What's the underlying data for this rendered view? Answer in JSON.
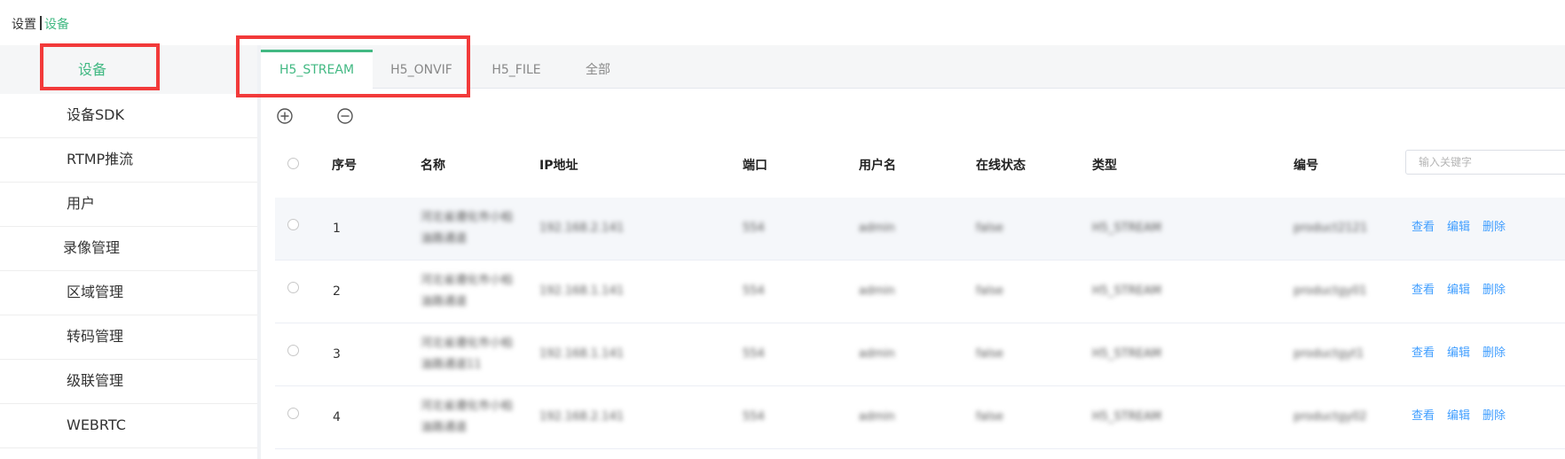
{
  "breadcrumb": {
    "root": "设置",
    "current": "设备"
  },
  "sidebar": {
    "header": "设备",
    "items": [
      {
        "label": "设备SDK"
      },
      {
        "label": "RTMP推流"
      },
      {
        "label": "用户"
      },
      {
        "label": "录像管理"
      },
      {
        "label": "区域管理"
      },
      {
        "label": "转码管理"
      },
      {
        "label": "级联管理"
      },
      {
        "label": "WEBRTC"
      }
    ]
  },
  "tabs": [
    {
      "label": "H5_STREAM",
      "active": true
    },
    {
      "label": "H5_ONVIF",
      "active": false
    },
    {
      "label": "H5_FILE",
      "active": false
    },
    {
      "label": "全部",
      "active": false
    }
  ],
  "toolbar": {
    "add_icon": "plus-circle-icon",
    "remove_icon": "minus-circle-icon"
  },
  "table": {
    "columns": [
      "序号",
      "名称",
      "IP地址",
      "端口",
      "用户名",
      "在线状态",
      "类型",
      "编号"
    ],
    "search_placeholder": "输入关键字",
    "actions": {
      "view": "查看",
      "edit": "编辑",
      "delete": "删除"
    },
    "rows": [
      {
        "index": "1",
        "name": "河北省遵化市小柏油路通道",
        "ip": "192.168.2.141",
        "port": "554",
        "user": "admin",
        "status": "false",
        "type": "H5_STREAM",
        "code": "product2121"
      },
      {
        "index": "2",
        "name": "河北省遵化市小柏油路通道",
        "ip": "192.168.1.141",
        "port": "554",
        "user": "admin",
        "status": "false",
        "type": "H5_STREAM",
        "code": "productgy01"
      },
      {
        "index": "3",
        "name": "河北省遵化市小柏油路通道11",
        "ip": "192.168.1.141",
        "port": "554",
        "user": "admin",
        "status": "false",
        "type": "H5_STREAM",
        "code": "productgyt1"
      },
      {
        "index": "4",
        "name": "河北省遵化市小柏油路通道",
        "ip": "192.168.2.141",
        "port": "554",
        "user": "admin",
        "status": "false",
        "type": "H5_STREAM",
        "code": "productgy02"
      }
    ]
  },
  "colors": {
    "accent": "#42b983",
    "link": "#409eff",
    "highlight_border": "#f23a3a"
  }
}
